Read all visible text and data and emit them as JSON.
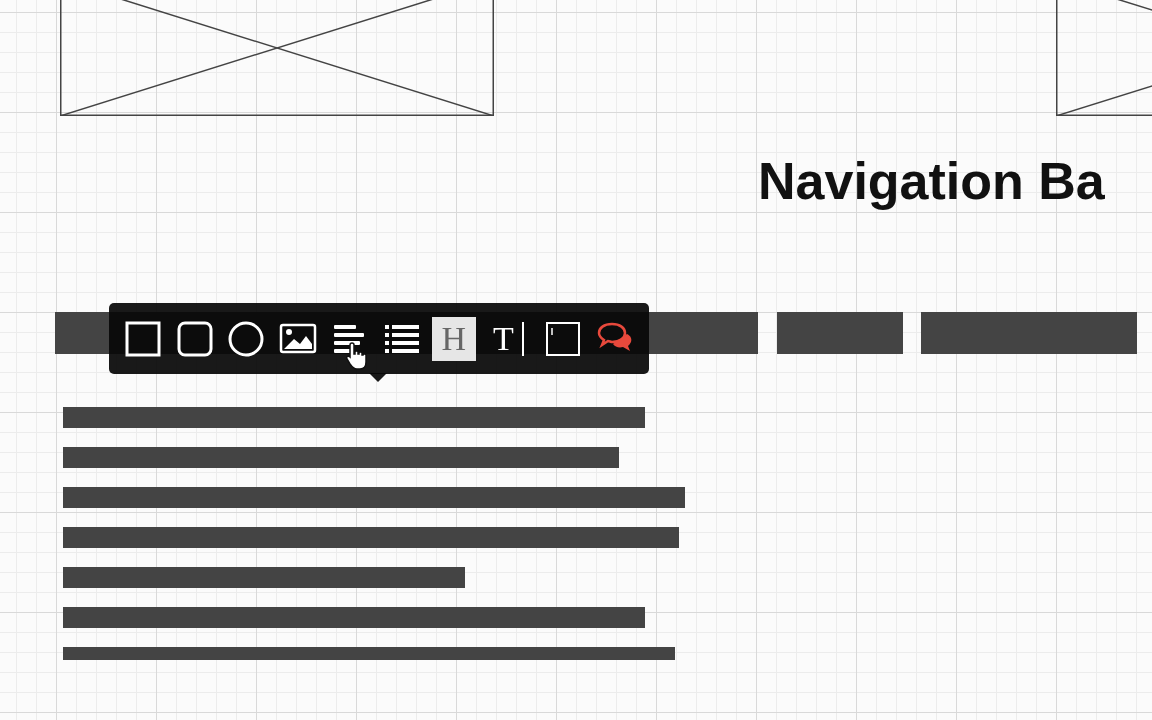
{
  "canvas": {
    "heading": "Navigation Ba"
  },
  "toolbar": {
    "tools": [
      {
        "kind": "rectangle",
        "selected": false
      },
      {
        "kind": "rounded",
        "selected": false
      },
      {
        "kind": "circle",
        "selected": false
      },
      {
        "kind": "image",
        "selected": false
      },
      {
        "kind": "paragraph",
        "selected": false,
        "hovered": true
      },
      {
        "kind": "list",
        "selected": false
      },
      {
        "kind": "heading",
        "label": "H",
        "selected": true
      },
      {
        "kind": "text",
        "label": "T",
        "selected": false
      },
      {
        "kind": "field",
        "selected": false
      },
      {
        "kind": "comment",
        "selected": false
      }
    ]
  }
}
